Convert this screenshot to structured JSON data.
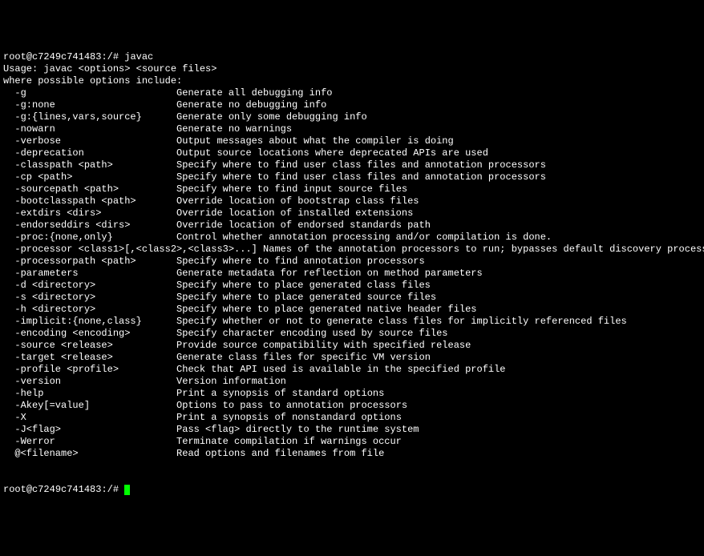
{
  "prompt_user": "root",
  "prompt_host": "c7249c741483",
  "prompt_path": "/",
  "prompt_suffix": "#",
  "command": "javac",
  "usage": "Usage: javac <options> <source files>",
  "where_line": "where possible options include:",
  "options": [
    {
      "flag": "-g",
      "desc": "Generate all debugging info"
    },
    {
      "flag": "-g:none",
      "desc": "Generate no debugging info"
    },
    {
      "flag": "-g:{lines,vars,source}",
      "desc": "Generate only some debugging info"
    },
    {
      "flag": "-nowarn",
      "desc": "Generate no warnings"
    },
    {
      "flag": "-verbose",
      "desc": "Output messages about what the compiler is doing"
    },
    {
      "flag": "-deprecation",
      "desc": "Output source locations where deprecated APIs are used"
    },
    {
      "flag": "-classpath <path>",
      "desc": "Specify where to find user class files and annotation processors"
    },
    {
      "flag": "-cp <path>",
      "desc": "Specify where to find user class files and annotation processors"
    },
    {
      "flag": "-sourcepath <path>",
      "desc": "Specify where to find input source files"
    },
    {
      "flag": "-bootclasspath <path>",
      "desc": "Override location of bootstrap class files"
    },
    {
      "flag": "-extdirs <dirs>",
      "desc": "Override location of installed extensions"
    },
    {
      "flag": "-endorseddirs <dirs>",
      "desc": "Override location of endorsed standards path"
    },
    {
      "flag": "-proc:{none,only}",
      "desc": "Control whether annotation processing and/or compilation is done."
    },
    {
      "flag": "-processor <class1>[,<class2>,<class3>...]",
      "desc": "Names of the annotation processors to run; bypasses default discovery process",
      "inline": true
    },
    {
      "flag": "-processorpath <path>",
      "desc": "Specify where to find annotation processors"
    },
    {
      "flag": "-parameters",
      "desc": "Generate metadata for reflection on method parameters"
    },
    {
      "flag": "-d <directory>",
      "desc": "Specify where to place generated class files"
    },
    {
      "flag": "-s <directory>",
      "desc": "Specify where to place generated source files"
    },
    {
      "flag": "-h <directory>",
      "desc": "Specify where to place generated native header files"
    },
    {
      "flag": "-implicit:{none,class}",
      "desc": "Specify whether or not to generate class files for implicitly referenced files"
    },
    {
      "flag": "-encoding <encoding>",
      "desc": "Specify character encoding used by source files"
    },
    {
      "flag": "-source <release>",
      "desc": "Provide source compatibility with specified release"
    },
    {
      "flag": "-target <release>",
      "desc": "Generate class files for specific VM version"
    },
    {
      "flag": "-profile <profile>",
      "desc": "Check that API used is available in the specified profile"
    },
    {
      "flag": "-version",
      "desc": "Version information"
    },
    {
      "flag": "-help",
      "desc": "Print a synopsis of standard options"
    },
    {
      "flag": "-Akey[=value]",
      "desc": "Options to pass to annotation processors"
    },
    {
      "flag": "-X",
      "desc": "Print a synopsis of nonstandard options"
    },
    {
      "flag": "-J<flag>",
      "desc": "Pass <flag> directly to the runtime system"
    },
    {
      "flag": "-Werror",
      "desc": "Terminate compilation if warnings occur"
    },
    {
      "flag": "@<filename>",
      "desc": "Read options and filenames from file"
    }
  ],
  "flag_col_width": 30,
  "indent": "  "
}
